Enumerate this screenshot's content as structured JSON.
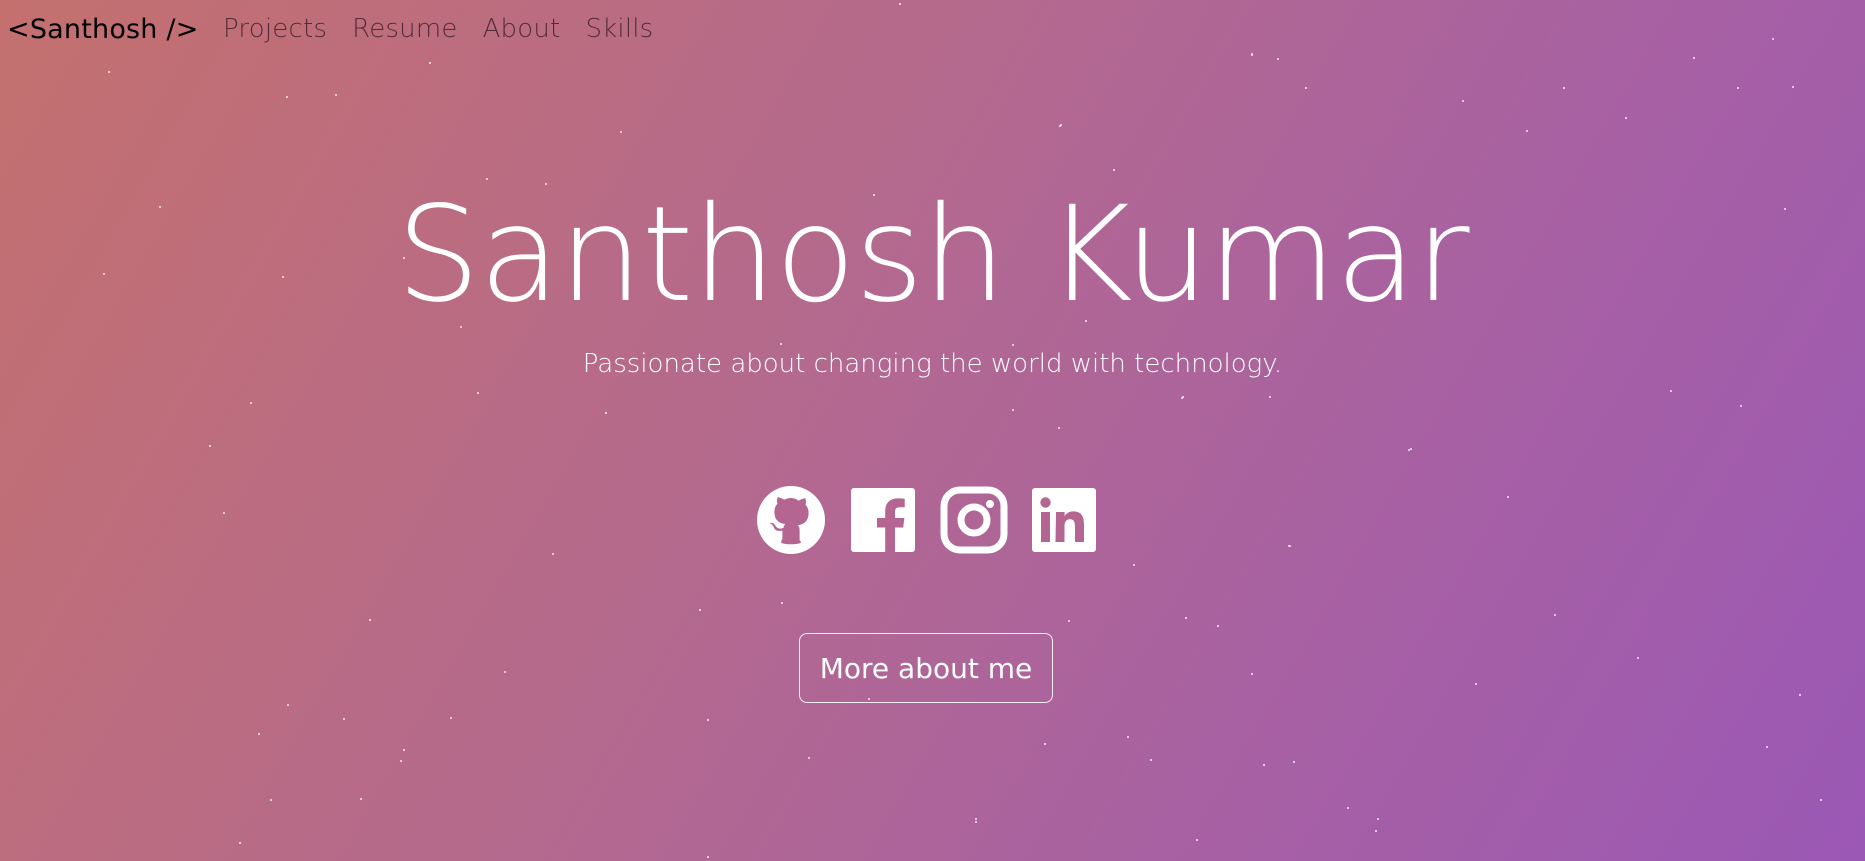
{
  "nav": {
    "brand": "<Santhosh />",
    "links": [
      "Projects",
      "Resume",
      "About",
      "Skills"
    ]
  },
  "hero": {
    "title": "Santhosh Kumar",
    "subtitle": "Passionate about changing the world with technology."
  },
  "socials": [
    {
      "name": "github",
      "icon": "github-icon"
    },
    {
      "name": "facebook",
      "icon": "facebook-icon"
    },
    {
      "name": "instagram",
      "icon": "instagram-icon"
    },
    {
      "name": "linkedin",
      "icon": "linkedin-icon"
    }
  ],
  "cta": {
    "label": "More about me"
  },
  "colors": {
    "gradient_start": "#c4706f",
    "gradient_mid": "#b56a8c",
    "gradient_end": "#9b58b5",
    "text": "#ffffff",
    "brand_text": "#000000"
  }
}
